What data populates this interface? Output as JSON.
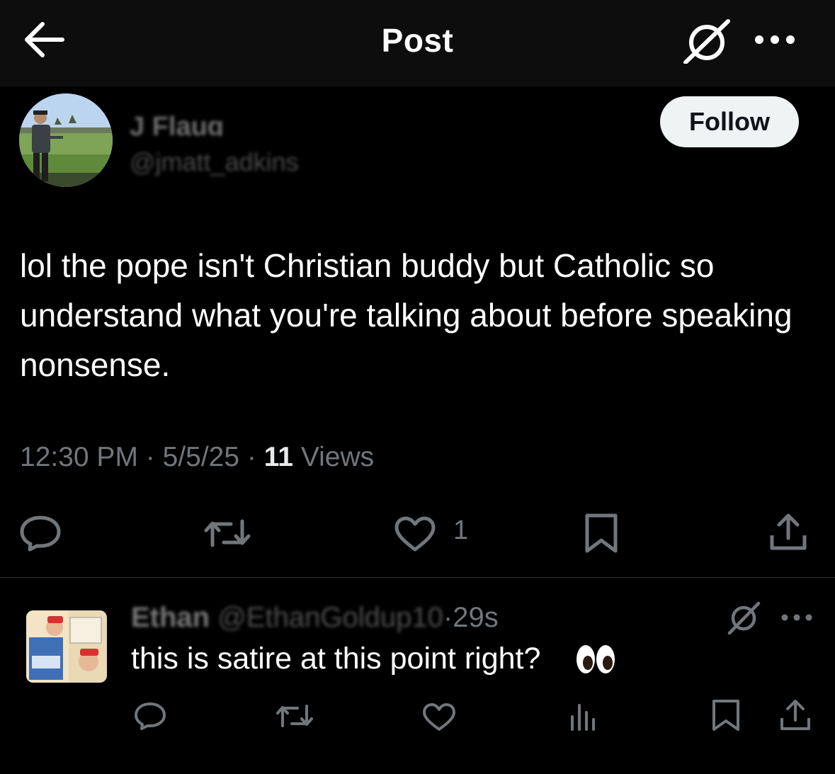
{
  "header": {
    "title": "Post",
    "back_icon": "arrow-left-icon",
    "grok_icon": "grok-icon",
    "more_icon": "more-dots-icon"
  },
  "post": {
    "author_name": "J Flaug",
    "author_handle": "@jmatt_adkins",
    "follow_label": "Follow",
    "text": "lol the pope isn't Christian buddy but Catholic so understand what you're talking about before speaking nonsense.",
    "time": "12:30 PM",
    "separator": "·",
    "date": "5/5/25",
    "views_count": "11",
    "views_label": "Views",
    "like_count": "1"
  },
  "reply": {
    "author_name": "Ethan",
    "author_handle": "@EthanGoldup10",
    "time_sep": "·",
    "time_ago": "29s",
    "text": "this is satire at this point right?"
  },
  "colors": {
    "background": "#000000",
    "topbar": "#0d0d0d",
    "text_primary": "#ffffff",
    "text_secondary": "#71767b",
    "follow_bg": "#eff3f4",
    "divider": "#2f3336"
  }
}
